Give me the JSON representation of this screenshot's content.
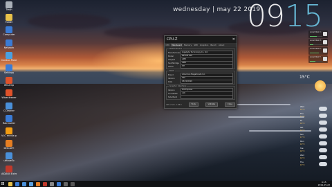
{
  "desktop": {
    "icons": [
      {
        "label": "Trash",
        "color": "#aab0b8"
      },
      {
        "label": "Folder",
        "color": "#e8c14a"
      },
      {
        "label": "Computer",
        "color": "#3a7bd5"
      },
      {
        "label": "Network",
        "color": "#3a7bd5"
      },
      {
        "label": "Control Panel",
        "color": "#4aa0e0"
      },
      {
        "label": "Settings",
        "color": "#3a7bd5"
      },
      {
        "label": "Winamp",
        "color": "#e0522a"
      },
      {
        "label": "Wisecleaner",
        "color": "#e0522a"
      },
      {
        "label": "CCleaner",
        "color": "#4a90d9"
      },
      {
        "label": "Rainmeter",
        "color": "#3a7bd5"
      },
      {
        "label": "VLC media player",
        "color": "#f39c12"
      },
      {
        "label": "DISCAFE",
        "color": "#e67e22"
      },
      {
        "label": "uMoveTo",
        "color": "#4a90d9"
      },
      {
        "label": "AIDA64 Extreme",
        "color": "#c0392b"
      }
    ]
  },
  "clock": {
    "date_text": "wednesday | may 22 2019",
    "hours": "09",
    "minutes": "15"
  },
  "cpuz": {
    "title": "CPU-Z",
    "close": "✕",
    "tabs": [
      "CPU",
      "Mainboard",
      "Memory",
      "SPD",
      "Graphics",
      "Bench",
      "About"
    ],
    "active_tab": 1,
    "motherboard": {
      "title": "Motherboard",
      "rows": [
        {
          "k": "Manufacturer",
          "v": "Gigabyte Technology Co. Ltd."
        },
        {
          "k": "Model",
          "v": "B450M S2H"
        },
        {
          "k": "Chipset",
          "v": "AMD"
        },
        {
          "k": "Southbridge",
          "v": "AMD"
        },
        {
          "k": "LPCIO",
          "v": "ITE"
        }
      ]
    },
    "bios": {
      "title": "BIOS",
      "rows": [
        {
          "k": "Brand",
          "v": "American Megatrends Inc."
        },
        {
          "k": "Version",
          "v": "F40"
        },
        {
          "k": "Date",
          "v": "03/29/2019"
        }
      ]
    },
    "gfx": {
      "title": "Graphic Interface",
      "rows": [
        {
          "k": "Version",
          "v": "PCI-Express"
        },
        {
          "k": "Link Width",
          "v": "x16"
        },
        {
          "k": "Side Band",
          "v": ""
        }
      ]
    },
    "version": "CPU-Z  Ver. 1.88.0",
    "tools_label": "Tools",
    "validate_label": "Validate",
    "close_label": "Close"
  },
  "widgets": [
    {
      "label": "Local Disk C:",
      "fill": 0.55
    },
    {
      "label": "Local Disk D:",
      "fill": 0.3
    },
    {
      "label": "Local Disk E:",
      "fill": 0.7
    },
    {
      "label": "Local Disk F:",
      "fill": 0.45
    }
  ],
  "weather": {
    "now": "15°C",
    "days": [
      {
        "d": "Wed",
        "t": "15°C"
      },
      {
        "d": "Thu",
        "t": "17°C"
      },
      {
        "d": "Fri",
        "t": "18°C"
      },
      {
        "d": "Sat",
        "t": "16°C"
      },
      {
        "d": "Sun",
        "t": "17°C"
      },
      {
        "d": "Mon",
        "t": "19°C"
      },
      {
        "d": "Tue",
        "t": "18°C"
      },
      {
        "d": "Wed",
        "t": "16°C"
      },
      {
        "d": "Thu",
        "t": "15°C"
      }
    ]
  },
  "taskbar": {
    "start": "⊞",
    "apps": [
      {
        "name": "file-explorer-icon",
        "color": "#e8c14a"
      },
      {
        "name": "browser-icon",
        "color": "#3a7bd5"
      },
      {
        "name": "store-icon",
        "color": "#4a90d9"
      },
      {
        "name": "mail-icon",
        "color": "#5aa0e0"
      },
      {
        "name": "media-icon",
        "color": "#e67e22"
      },
      {
        "name": "music-icon",
        "color": "#c0392b"
      },
      {
        "name": "settings-icon",
        "color": "#888888"
      },
      {
        "name": "photos-icon",
        "color": "#3a7bd5"
      },
      {
        "name": "cpu-icon",
        "color": "#666666"
      },
      {
        "name": "terminal-icon",
        "color": "#555555"
      }
    ],
    "time": "9:15",
    "date": "2019-05-22"
  }
}
